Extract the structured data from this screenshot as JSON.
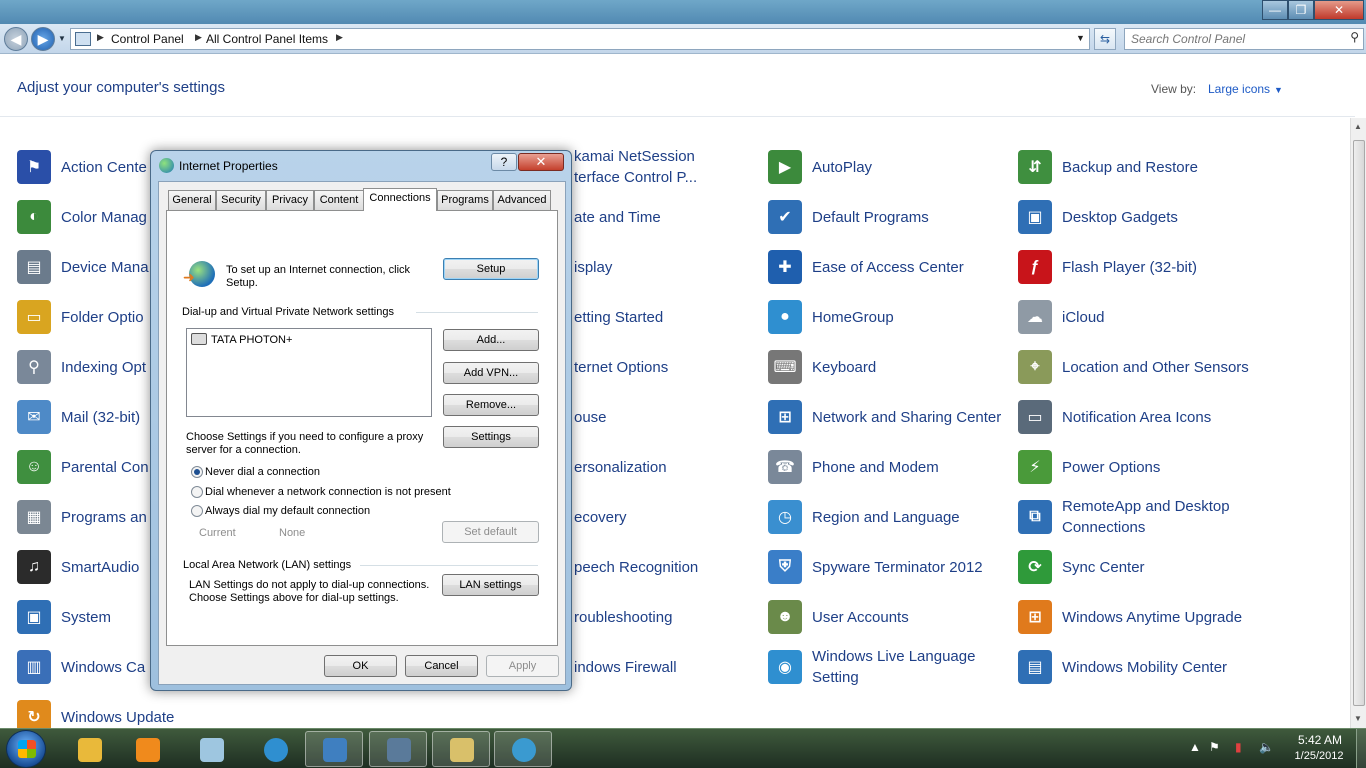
{
  "window": {
    "controls": {
      "minimize": "—",
      "maximize": "❐",
      "close": "✕"
    }
  },
  "address_bar": {
    "breadcrumbs": [
      "Control Panel",
      "All Control Panel Items"
    ],
    "search_placeholder": "Search Control Panel"
  },
  "content": {
    "heading": "Adjust your computer's settings",
    "view_by_label": "View by:",
    "view_by_value": "Large icons"
  },
  "items": {
    "col1": [
      {
        "label": "Action Cente",
        "icon": "action-center-icon",
        "color": "#2a4fa8"
      },
      {
        "label": "Color Manag",
        "icon": "color-management-icon",
        "color": "#3c8a3c"
      },
      {
        "label": "Device Mana",
        "icon": "device-manager-icon",
        "color": "#6b7b8c"
      },
      {
        "label": "Folder Optio",
        "icon": "folder-options-icon",
        "color": "#d9a520"
      },
      {
        "label": "Indexing Opt",
        "icon": "indexing-options-icon",
        "color": "#7a8899"
      },
      {
        "label": "Mail (32-bit)",
        "icon": "mail-icon",
        "color": "#4e8ac7"
      },
      {
        "label": "Parental Con",
        "icon": "parental-controls-icon",
        "color": "#3f8f3f"
      },
      {
        "label": "Programs an",
        "icon": "programs-features-icon",
        "color": "#7b8793"
      },
      {
        "label": "SmartAudio",
        "icon": "smartaudio-icon",
        "color": "#2b2b2b"
      },
      {
        "label": "System",
        "icon": "system-icon",
        "color": "#2f6fb5"
      },
      {
        "label": "Windows Ca",
        "icon": "windows-cardspace-icon",
        "color": "#3a6fb8"
      },
      {
        "label": "Windows Update",
        "icon": "windows-update-icon",
        "color": "#e08a1c"
      }
    ],
    "col2": [
      {
        "label": "kamai NetSession Interface Control P...",
        "line1": "kamai NetSession",
        "line2": "terface Control P..."
      },
      {
        "label": "ate and Time",
        "line1": "ate and Time",
        "line2": ""
      },
      {
        "label": "isplay",
        "line1": "isplay",
        "line2": ""
      },
      {
        "label": "etting Started",
        "line1": "etting Started",
        "line2": ""
      },
      {
        "label": "ternet Options",
        "line1": "ternet Options",
        "line2": ""
      },
      {
        "label": "ouse",
        "line1": "ouse",
        "line2": ""
      },
      {
        "label": "ersonalization",
        "line1": "ersonalization",
        "line2": ""
      },
      {
        "label": "ecovery",
        "line1": "ecovery",
        "line2": ""
      },
      {
        "label": "peech Recognition",
        "line1": "peech Recognition",
        "line2": ""
      },
      {
        "label": "roubleshooting",
        "line1": "roubleshooting",
        "line2": ""
      },
      {
        "label": "indows Firewall",
        "line1": "indows Firewall",
        "line2": ""
      }
    ],
    "col3": [
      {
        "label": "AutoPlay",
        "icon": "autoplay-icon",
        "color": "#3c8a3c"
      },
      {
        "label": "Default Programs",
        "icon": "default-programs-icon",
        "color": "#2f6fb5"
      },
      {
        "label": "Ease of Access Center",
        "icon": "ease-of-access-icon",
        "color": "#1f5fae"
      },
      {
        "label": "HomeGroup",
        "icon": "homegroup-icon",
        "color": "#2f8fd0"
      },
      {
        "label": "Keyboard",
        "icon": "keyboard-icon",
        "color": "#777777"
      },
      {
        "label": "Network and Sharing Center",
        "icon": "network-sharing-icon",
        "color": "#2f6fb5"
      },
      {
        "label": "Phone and Modem",
        "icon": "phone-modem-icon",
        "color": "#7a8899"
      },
      {
        "label": "Region and Language",
        "icon": "region-language-icon",
        "color": "#3a8fd0"
      },
      {
        "label": "Spyware Terminator 2012",
        "icon": "spyware-terminator-icon",
        "color": "#3a7ec8"
      },
      {
        "label": "User Accounts",
        "icon": "user-accounts-icon",
        "color": "#6a8a4a"
      },
      {
        "label": "Windows Live Language Setting",
        "icon": "windows-live-language-icon",
        "color": "#2f8fd0"
      }
    ],
    "col4": [
      {
        "label": "Backup and Restore",
        "icon": "backup-restore-icon",
        "color": "#3f8f3f"
      },
      {
        "label": "Desktop Gadgets",
        "icon": "desktop-gadgets-icon",
        "color": "#2f6fb5"
      },
      {
        "label": "Flash Player (32-bit)",
        "icon": "flash-player-icon",
        "color": "#c8141a"
      },
      {
        "label": "iCloud",
        "icon": "icloud-icon",
        "color": "#8f9aa5"
      },
      {
        "label": "Location and Other Sensors",
        "icon": "location-sensors-icon",
        "color": "#8a9a5a"
      },
      {
        "label": "Notification Area Icons",
        "icon": "notification-area-icon",
        "color": "#5a6a7a"
      },
      {
        "label": "Power Options",
        "icon": "power-options-icon",
        "color": "#4a9a3a"
      },
      {
        "label": "RemoteApp and Desktop Connections",
        "icon": "remoteapp-icon",
        "color": "#2f6fb5"
      },
      {
        "label": "Sync Center",
        "icon": "sync-center-icon",
        "color": "#2f9a3a"
      },
      {
        "label": "Windows Anytime Upgrade",
        "icon": "windows-anytime-upgrade-icon",
        "color": "#e07a1c"
      },
      {
        "label": "Windows Mobility Center",
        "icon": "mobility-center-icon",
        "color": "#2f6fb5"
      }
    ]
  },
  "dialog": {
    "title": "Internet Properties",
    "help": "?",
    "close": "✕",
    "tabs": [
      "General",
      "Security",
      "Privacy",
      "Content",
      "Connections",
      "Programs",
      "Advanced"
    ],
    "active_tab": "Connections",
    "setup_text_1": "To set up an Internet connection, click",
    "setup_text_2": "Setup.",
    "setup_button": "Setup",
    "dialup_group": "Dial-up and Virtual Private Network settings",
    "connections": [
      "TATA PHOTON+"
    ],
    "add_button": "Add...",
    "add_vpn_button": "Add VPN...",
    "remove_button": "Remove...",
    "proxy_text_1": "Choose Settings if you need to configure a proxy",
    "proxy_text_2": "server for a connection.",
    "settings_button": "Settings",
    "radio_never": "Never dial a connection",
    "radio_whenever": "Dial whenever a network connection is not present",
    "radio_always": "Always dial my default connection",
    "selected_radio": "Never dial a connection",
    "current_label": "Current",
    "current_value": "None",
    "set_default_button": "Set default",
    "lan_group": "Local Area Network (LAN) settings",
    "lan_text_1": "LAN Settings do not apply to dial-up connections.",
    "lan_text_2": "Choose Settings above for dial-up settings.",
    "lan_button": "LAN settings",
    "ok_button": "OK",
    "cancel_button": "Cancel",
    "apply_button": "Apply"
  },
  "taskbar": {
    "apps": [
      "windows-explorer-icon",
      "media-player-icon",
      "notepad-icon",
      "internet-explorer-icon",
      "control-panel-icon",
      "device-icon",
      "paint-icon",
      "internet-properties-icon"
    ],
    "time": "5:42 AM",
    "date": "1/25/2012"
  }
}
